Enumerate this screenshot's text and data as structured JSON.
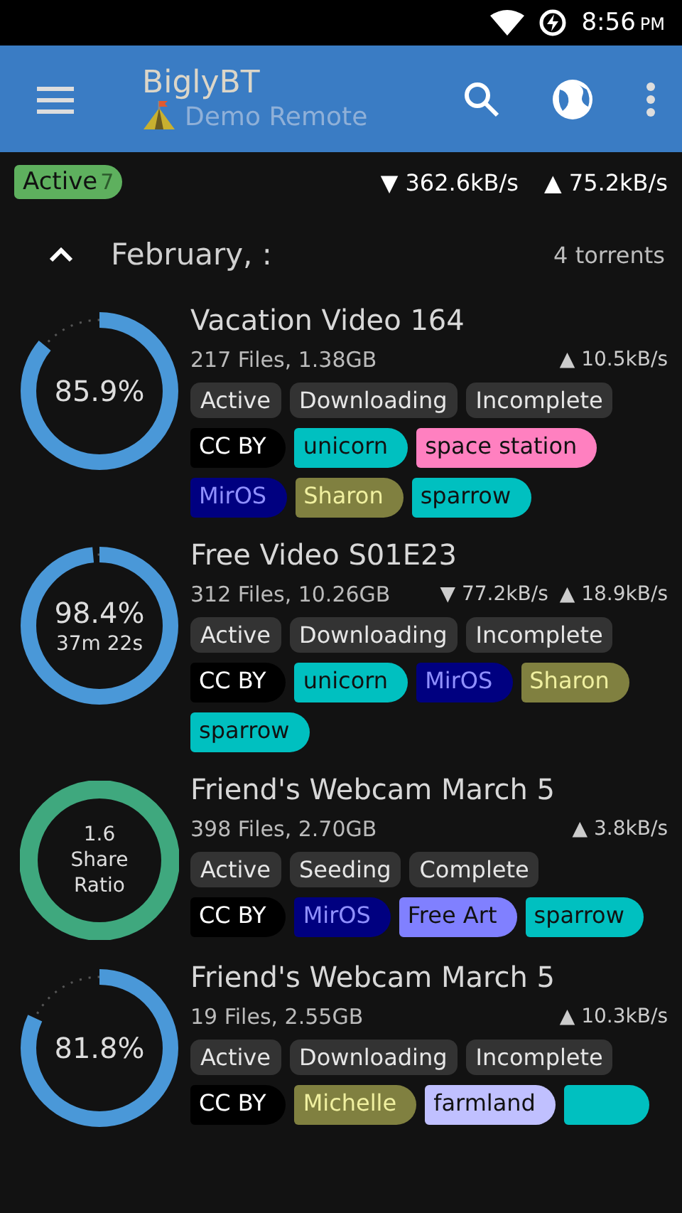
{
  "status_bar": {
    "time": "8:56",
    "ampm": "PM"
  },
  "app_bar": {
    "title": "BiglyBT",
    "subtitle": "Demo Remote"
  },
  "filter": {
    "label": "Active",
    "count": "7",
    "down": "▼ 362.6kB/s",
    "up": "▲ 75.2kB/s"
  },
  "group": {
    "title": "February, :",
    "count": "4 torrents",
    "expanded": true
  },
  "torrents": [
    {
      "name": "Vacation Video 164",
      "info": "217 Files, 1.38GB",
      "up": "▲ 10.5kB/s",
      "ring": {
        "kind": "progress",
        "lines": [
          "85.9%"
        ]
      },
      "states": [
        "Active",
        "Downloading",
        "Incomplete"
      ],
      "tags": [
        {
          "label": "CC BY",
          "color": "#000000"
        },
        {
          "label": "unicorn",
          "color": "#00c0c0"
        },
        {
          "label": "space station",
          "color": "#ff80c0"
        },
        {
          "label": "MirOS",
          "color": "#000080"
        },
        {
          "label": "Sharon",
          "color": "#808040"
        },
        {
          "label": "sparrow",
          "color": "#00c0c0"
        }
      ]
    },
    {
      "name": "Free Video S01E23",
      "info": "312 Files, 10.26GB",
      "down": "▼ 77.2kB/s",
      "up": "▲ 18.9kB/s",
      "ring": {
        "kind": "progress",
        "lines": [
          "98.4%",
          "37m 22s"
        ]
      },
      "states": [
        "Active",
        "Downloading",
        "Incomplete"
      ],
      "tags": [
        {
          "label": "CC BY",
          "color": "#000000"
        },
        {
          "label": "unicorn",
          "color": "#00c0c0"
        },
        {
          "label": "MirOS",
          "color": "#000080"
        },
        {
          "label": "Sharon",
          "color": "#808040"
        },
        {
          "label": "sparrow",
          "color": "#00c0c0"
        }
      ]
    },
    {
      "name": "Friend's Webcam March 5",
      "info": "398 Files, 2.70GB",
      "up": "▲ 3.8kB/s",
      "ring": {
        "kind": "ratio",
        "lines": [
          "1.6",
          "Share",
          "Ratio"
        ]
      },
      "states": [
        "Active",
        "Seeding",
        "Complete"
      ],
      "tags": [
        {
          "label": "CC BY",
          "color": "#000000"
        },
        {
          "label": "MirOS",
          "color": "#000080"
        },
        {
          "label": "Free Art",
          "color": "#8080ff"
        },
        {
          "label": "sparrow",
          "color": "#00c0c0"
        }
      ]
    },
    {
      "name": "Friend's Webcam March 5",
      "info": "19 Files, 2.55GB",
      "up": "▲ 10.3kB/s",
      "ring": {
        "kind": "progress",
        "lines": [
          "81.8%"
        ]
      },
      "states": [
        "Active",
        "Downloading",
        "Incomplete"
      ],
      "tags": [
        {
          "label": "CC BY",
          "color": "#000000"
        },
        {
          "label": "Michelle",
          "color": "#808040"
        },
        {
          "label": "farmland",
          "color": "#c0c0ff"
        },
        {
          "color": "#00c0c0"
        }
      ]
    }
  ]
}
